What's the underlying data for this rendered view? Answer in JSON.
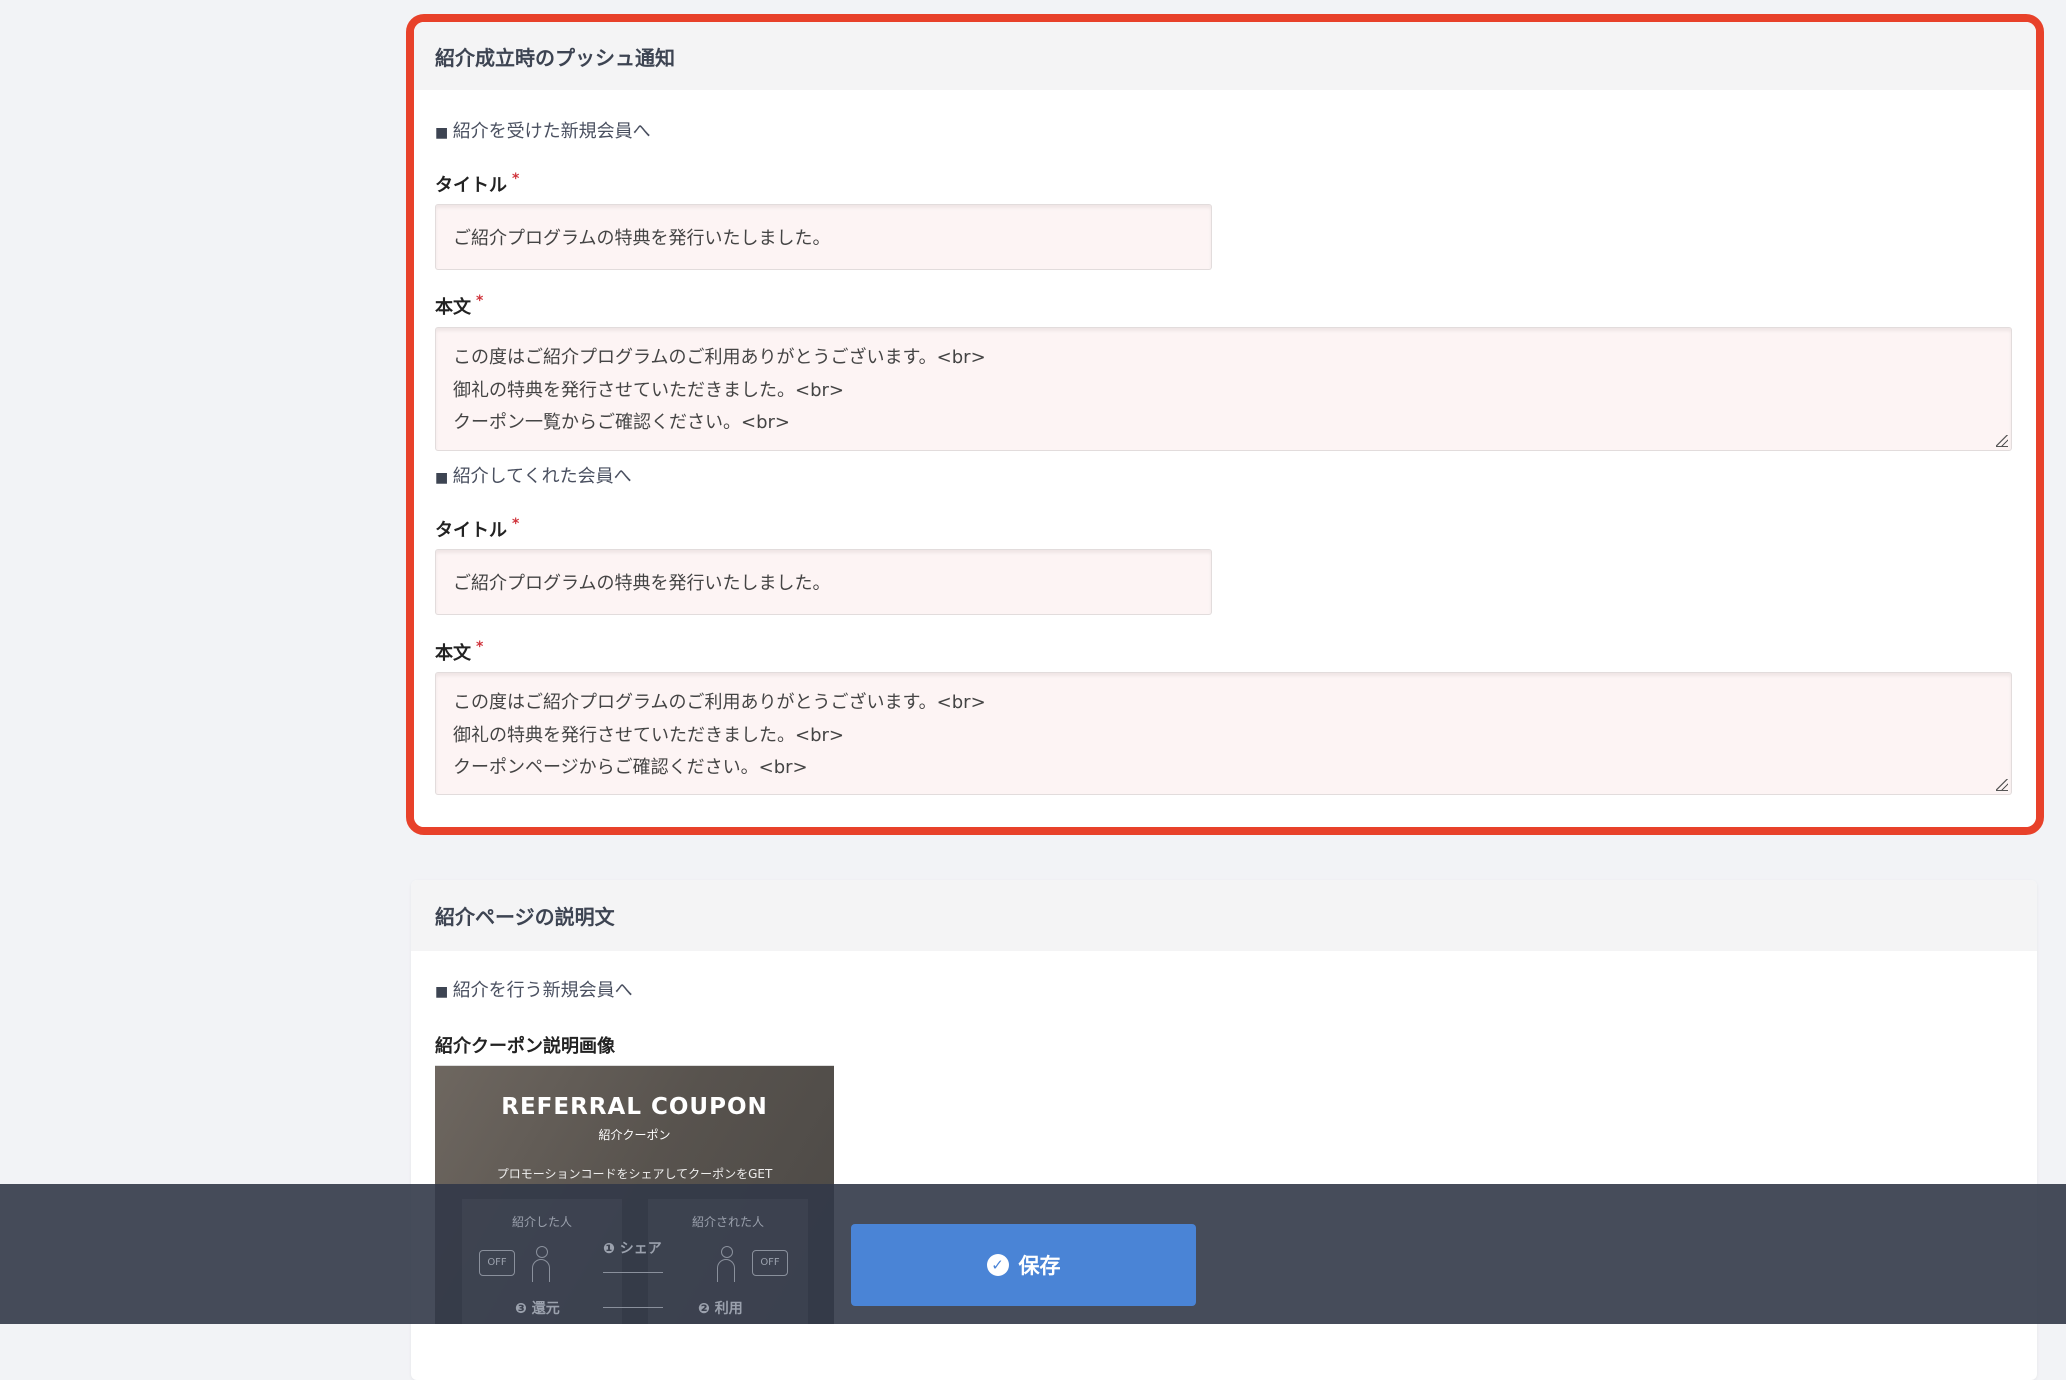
{
  "push_card": {
    "title": "紹介成立時のプッシュ通知",
    "new_member": {
      "section": "紹介を受けた新規会員へ",
      "title_label": "タイトル",
      "body_label": "本文",
      "required": "*",
      "title_value": "ご紹介プログラムの特典を発行いたしました。",
      "body_lines": [
        "この度はご紹介プログラムのご利用ありがとうございます。<br>",
        "御礼の特典を発行させていただきました。<br>",
        "クーポン一覧からご確認ください。<br>"
      ]
    },
    "referrer": {
      "section": "紹介してくれた会員へ",
      "title_label": "タイトル",
      "body_label": "本文",
      "required": "*",
      "title_value": "ご紹介プログラムの特典を発行いたしました。",
      "body_lines": [
        "この度はご紹介プログラムのご利用ありがとうございます。<br>",
        "御礼の特典を発行させていただきました。<br>",
        "クーポンページからご確認ください。<br>"
      ]
    }
  },
  "desc_card": {
    "title": "紹介ページの説明文",
    "section": "紹介を行う新規会員へ",
    "image_label": "紹介クーポン説明画像",
    "image": {
      "heading": "REFERRAL COUPON",
      "sub": "紹介クーポン",
      "tagline": "プロモーションコードをシェアしてクーポンをGET",
      "left": "紹介した人",
      "right": "紹介された人",
      "step1": "❶ シェア",
      "step2": "❷ 利用",
      "step3": "❸ 還元",
      "off": "OFF"
    }
  },
  "footer": {
    "save_label": "保存"
  }
}
